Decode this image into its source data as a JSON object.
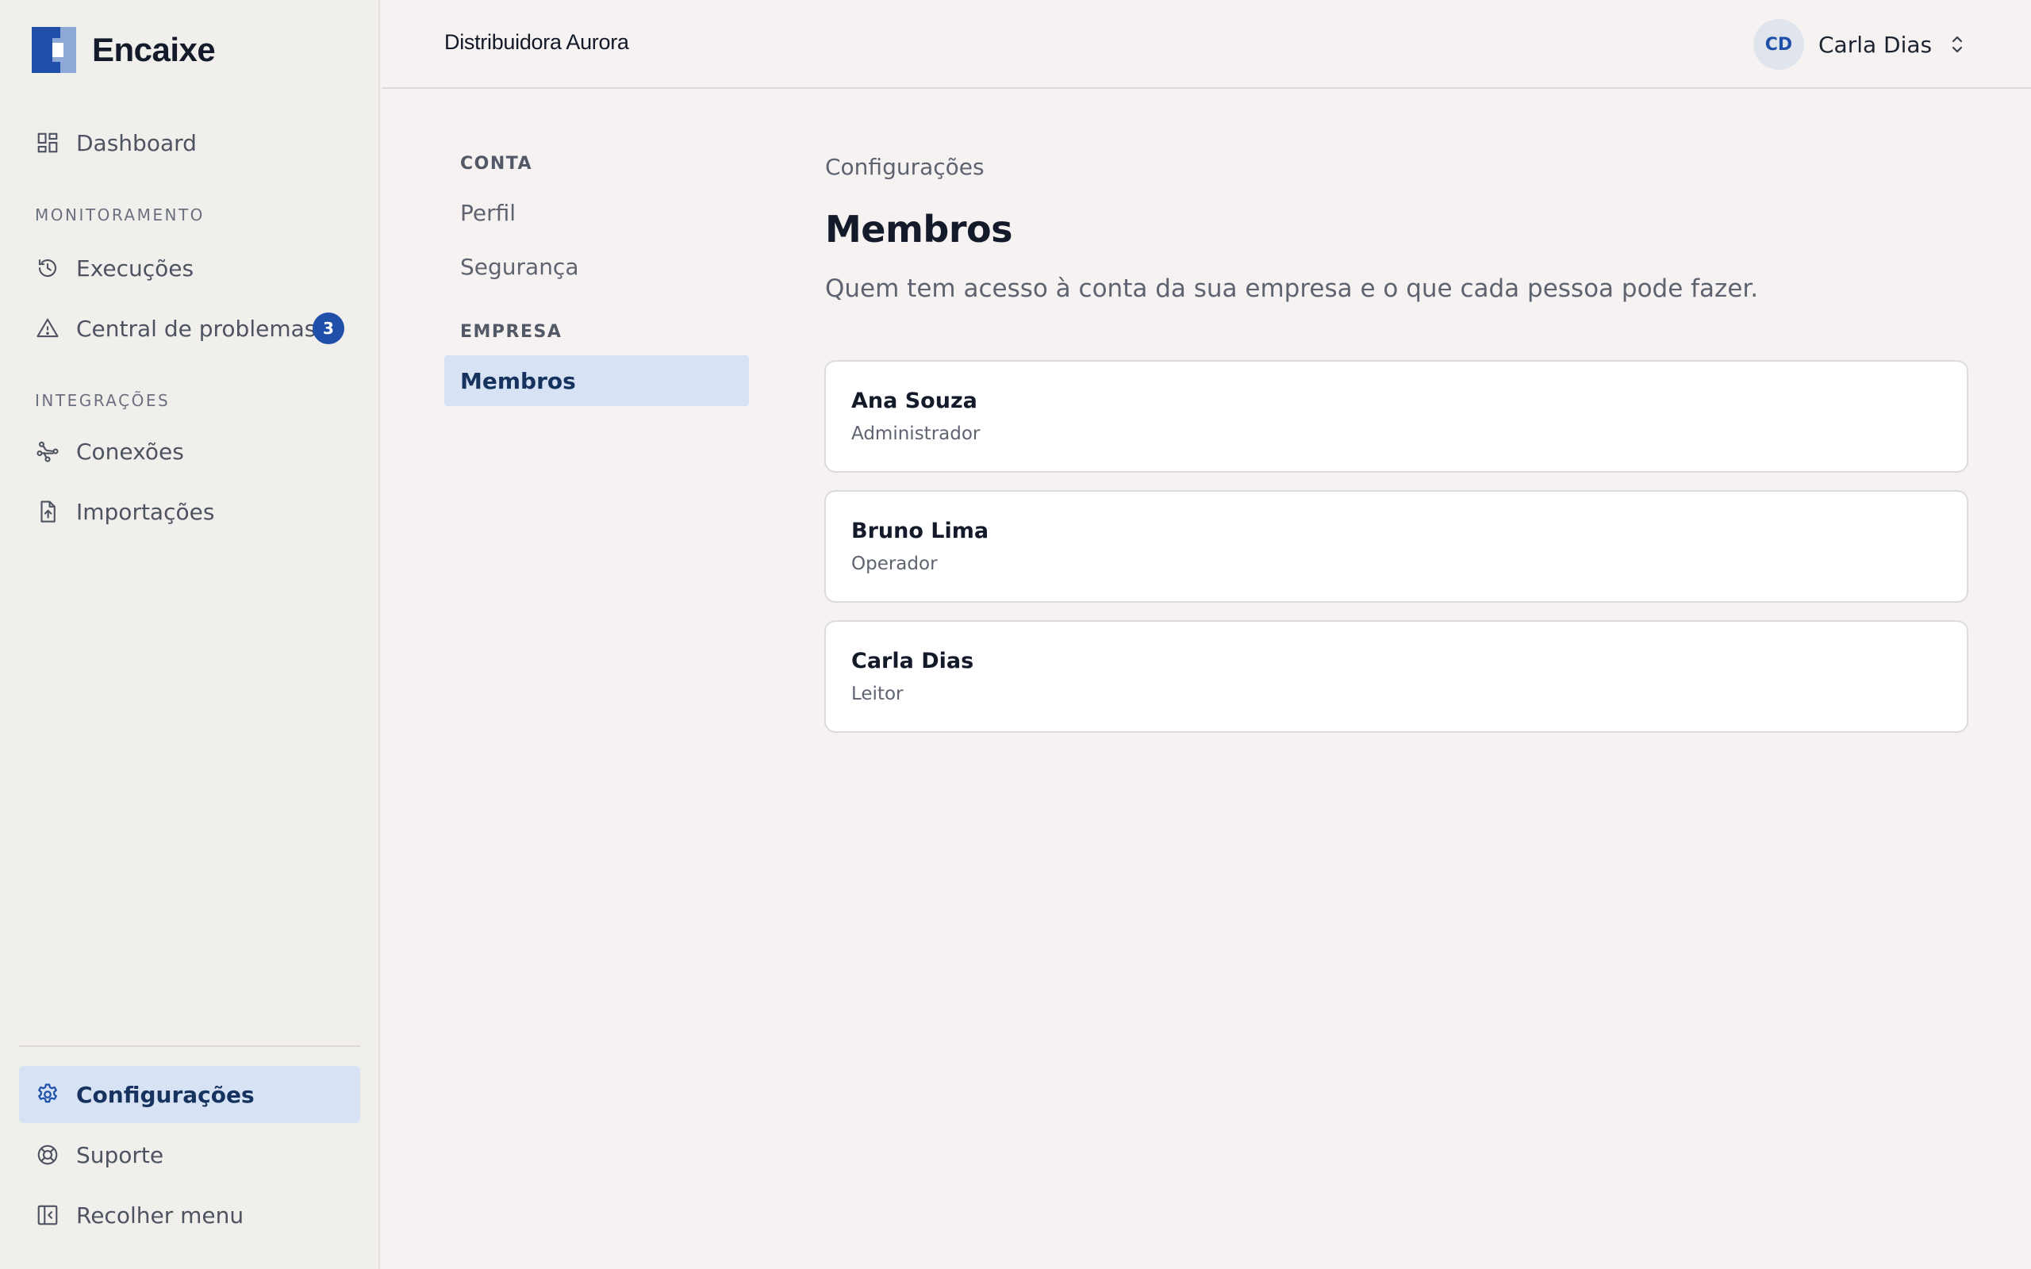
{
  "app": {
    "name": "Encaixe",
    "colors": {
      "accent": "#1f4fa8",
      "active_bg": "#d7e3f4",
      "sidebar_bg": "#f1efec",
      "page_bg": "#f6f2f2"
    }
  },
  "sidebar": {
    "dashboard": {
      "label": "Dashboard",
      "icon": "dashboard-icon"
    },
    "sections": [
      {
        "title": "MONITORAMENTO",
        "items": [
          {
            "label": "Execuções",
            "icon": "history-icon"
          },
          {
            "label": "Central de problemas",
            "icon": "alert-triangle-icon",
            "badge": "3"
          }
        ]
      },
      {
        "title": "INTEGRAÇÕES",
        "items": [
          {
            "label": "Conexões",
            "icon": "connection-icon"
          },
          {
            "label": "Importações",
            "icon": "file-upload-icon"
          }
        ]
      }
    ],
    "bottom": [
      {
        "label": "Configurações",
        "icon": "gear-icon",
        "active": true
      },
      {
        "label": "Suporte",
        "icon": "lifebuoy-icon"
      },
      {
        "label": "Recolher menu",
        "icon": "collapse-sidebar-icon"
      }
    ]
  },
  "header": {
    "org_name": "Distribuidora Aurora",
    "user": {
      "initials": "CD",
      "name": "Carla Dias"
    }
  },
  "settings_nav": {
    "sections": [
      {
        "title": "CONTA",
        "items": [
          "Perfil",
          "Segurança"
        ]
      },
      {
        "title": "EMPRESA",
        "items": [
          "Membros"
        ]
      }
    ],
    "active": "Membros"
  },
  "main": {
    "breadcrumb": "Configurações",
    "title": "Membros",
    "subtitle": "Quem tem acesso à conta da sua empresa e o que cada pessoa pode fazer.",
    "members": [
      {
        "name": "Ana Souza",
        "role": "Administrador"
      },
      {
        "name": "Bruno Lima",
        "role": "Operador"
      },
      {
        "name": "Carla Dias",
        "role": "Leitor"
      }
    ]
  }
}
